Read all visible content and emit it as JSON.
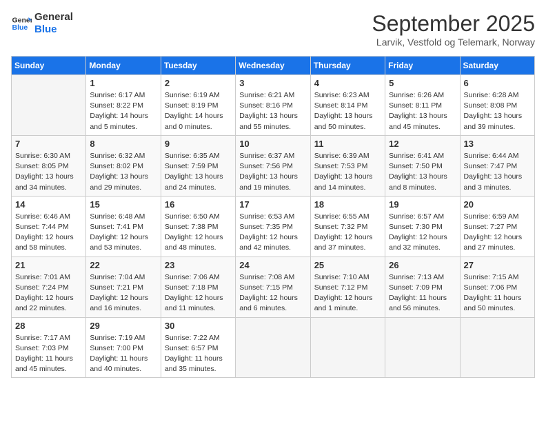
{
  "header": {
    "logo_line1": "General",
    "logo_line2": "Blue",
    "month": "September 2025",
    "location": "Larvik, Vestfold og Telemark, Norway"
  },
  "days_of_week": [
    "Sunday",
    "Monday",
    "Tuesday",
    "Wednesday",
    "Thursday",
    "Friday",
    "Saturday"
  ],
  "weeks": [
    [
      {
        "day": "",
        "info": ""
      },
      {
        "day": "1",
        "info": "Sunrise: 6:17 AM\nSunset: 8:22 PM\nDaylight: 14 hours\nand 5 minutes."
      },
      {
        "day": "2",
        "info": "Sunrise: 6:19 AM\nSunset: 8:19 PM\nDaylight: 14 hours\nand 0 minutes."
      },
      {
        "day": "3",
        "info": "Sunrise: 6:21 AM\nSunset: 8:16 PM\nDaylight: 13 hours\nand 55 minutes."
      },
      {
        "day": "4",
        "info": "Sunrise: 6:23 AM\nSunset: 8:14 PM\nDaylight: 13 hours\nand 50 minutes."
      },
      {
        "day": "5",
        "info": "Sunrise: 6:26 AM\nSunset: 8:11 PM\nDaylight: 13 hours\nand 45 minutes."
      },
      {
        "day": "6",
        "info": "Sunrise: 6:28 AM\nSunset: 8:08 PM\nDaylight: 13 hours\nand 39 minutes."
      }
    ],
    [
      {
        "day": "7",
        "info": "Sunrise: 6:30 AM\nSunset: 8:05 PM\nDaylight: 13 hours\nand 34 minutes."
      },
      {
        "day": "8",
        "info": "Sunrise: 6:32 AM\nSunset: 8:02 PM\nDaylight: 13 hours\nand 29 minutes."
      },
      {
        "day": "9",
        "info": "Sunrise: 6:35 AM\nSunset: 7:59 PM\nDaylight: 13 hours\nand 24 minutes."
      },
      {
        "day": "10",
        "info": "Sunrise: 6:37 AM\nSunset: 7:56 PM\nDaylight: 13 hours\nand 19 minutes."
      },
      {
        "day": "11",
        "info": "Sunrise: 6:39 AM\nSunset: 7:53 PM\nDaylight: 13 hours\nand 14 minutes."
      },
      {
        "day": "12",
        "info": "Sunrise: 6:41 AM\nSunset: 7:50 PM\nDaylight: 13 hours\nand 8 minutes."
      },
      {
        "day": "13",
        "info": "Sunrise: 6:44 AM\nSunset: 7:47 PM\nDaylight: 13 hours\nand 3 minutes."
      }
    ],
    [
      {
        "day": "14",
        "info": "Sunrise: 6:46 AM\nSunset: 7:44 PM\nDaylight: 12 hours\nand 58 minutes."
      },
      {
        "day": "15",
        "info": "Sunrise: 6:48 AM\nSunset: 7:41 PM\nDaylight: 12 hours\nand 53 minutes."
      },
      {
        "day": "16",
        "info": "Sunrise: 6:50 AM\nSunset: 7:38 PM\nDaylight: 12 hours\nand 48 minutes."
      },
      {
        "day": "17",
        "info": "Sunrise: 6:53 AM\nSunset: 7:35 PM\nDaylight: 12 hours\nand 42 minutes."
      },
      {
        "day": "18",
        "info": "Sunrise: 6:55 AM\nSunset: 7:32 PM\nDaylight: 12 hours\nand 37 minutes."
      },
      {
        "day": "19",
        "info": "Sunrise: 6:57 AM\nSunset: 7:30 PM\nDaylight: 12 hours\nand 32 minutes."
      },
      {
        "day": "20",
        "info": "Sunrise: 6:59 AM\nSunset: 7:27 PM\nDaylight: 12 hours\nand 27 minutes."
      }
    ],
    [
      {
        "day": "21",
        "info": "Sunrise: 7:01 AM\nSunset: 7:24 PM\nDaylight: 12 hours\nand 22 minutes."
      },
      {
        "day": "22",
        "info": "Sunrise: 7:04 AM\nSunset: 7:21 PM\nDaylight: 12 hours\nand 16 minutes."
      },
      {
        "day": "23",
        "info": "Sunrise: 7:06 AM\nSunset: 7:18 PM\nDaylight: 12 hours\nand 11 minutes."
      },
      {
        "day": "24",
        "info": "Sunrise: 7:08 AM\nSunset: 7:15 PM\nDaylight: 12 hours\nand 6 minutes."
      },
      {
        "day": "25",
        "info": "Sunrise: 7:10 AM\nSunset: 7:12 PM\nDaylight: 12 hours\nand 1 minute."
      },
      {
        "day": "26",
        "info": "Sunrise: 7:13 AM\nSunset: 7:09 PM\nDaylight: 11 hours\nand 56 minutes."
      },
      {
        "day": "27",
        "info": "Sunrise: 7:15 AM\nSunset: 7:06 PM\nDaylight: 11 hours\nand 50 minutes."
      }
    ],
    [
      {
        "day": "28",
        "info": "Sunrise: 7:17 AM\nSunset: 7:03 PM\nDaylight: 11 hours\nand 45 minutes."
      },
      {
        "day": "29",
        "info": "Sunrise: 7:19 AM\nSunset: 7:00 PM\nDaylight: 11 hours\nand 40 minutes."
      },
      {
        "day": "30",
        "info": "Sunrise: 7:22 AM\nSunset: 6:57 PM\nDaylight: 11 hours\nand 35 minutes."
      },
      {
        "day": "",
        "info": ""
      },
      {
        "day": "",
        "info": ""
      },
      {
        "day": "",
        "info": ""
      },
      {
        "day": "",
        "info": ""
      }
    ]
  ]
}
